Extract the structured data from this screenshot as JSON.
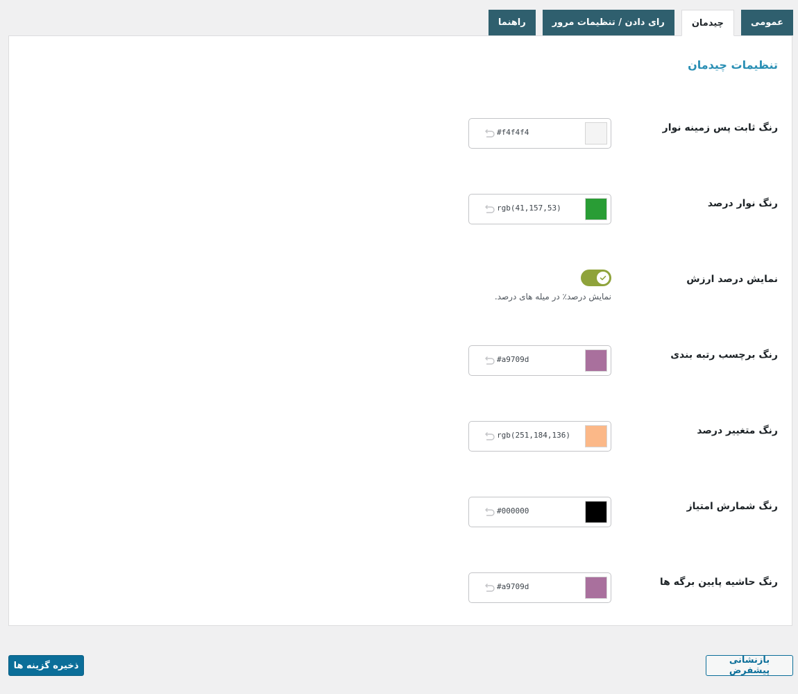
{
  "tabs": [
    {
      "label": "عمومی",
      "active": false
    },
    {
      "label": "چیدمان",
      "active": true
    },
    {
      "label": "رای دادن / تنظیمات مرور",
      "active": false
    },
    {
      "label": "راهنما",
      "active": false
    }
  ],
  "panel": {
    "title": "تنظیمات چیدمان"
  },
  "settings": {
    "bar_bg_color": {
      "label": "رنگ ثابت پس زمینه نوار",
      "value": "#f4f4f4",
      "swatch": "#f4f4f4"
    },
    "percent_bar_color": {
      "label": "رنگ نوار درصد",
      "value": "rgb(41,157,53)",
      "swatch": "#299d35"
    },
    "show_percent": {
      "label": "نمایش درصد ارزش",
      "description": "نمایش درصد٪ در میله های درصد.",
      "enabled": true,
      "color": "#8fa33b"
    },
    "rating_label_color": {
      "label": "رنگ برچسب رتبه بندی",
      "value": "#a9709d",
      "swatch": "#a9709d"
    },
    "percent_variable_color": {
      "label": "رنگ متغییر درصد",
      "value": "rgb(251,184,136)",
      "swatch": "#fbb888"
    },
    "score_count_color": {
      "label": "رنگ شمارش امتیاز",
      "value": "#000000",
      "swatch": "#000000"
    },
    "page_bottom_border_color": {
      "label": "رنگ حاشیه پایین برگه ها",
      "value": "#a9709d",
      "swatch": "#a9709d"
    }
  },
  "buttons": {
    "save_label": "ذخیره گزینه ها",
    "reset_label": "بازنشانی پیشفرض"
  },
  "colors": {
    "tab_bg": "#2f5f6e",
    "title": "#2a8fb4",
    "primary_button": "#0b6e99"
  }
}
